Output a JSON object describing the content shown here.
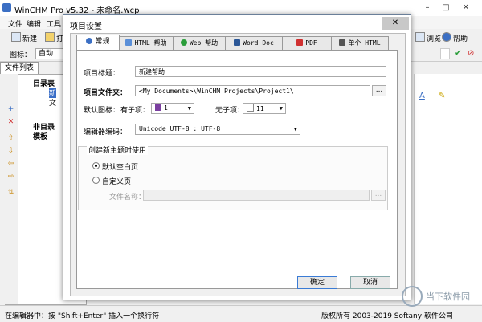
{
  "window": {
    "title": "WinCHM Pro v5.32 - 未命名.wcp"
  },
  "menu": [
    "文件",
    "编辑",
    "工具"
  ],
  "toolbar": {
    "new_label": "新建",
    "open_label": "打开",
    "view_label": "浏览",
    "help_label": "帮助",
    "icon_label": "图标：",
    "icon_value": "自动"
  },
  "side_tab": "文件列表",
  "tree": [
    "目录表",
    "新",
    "文",
    "非目录",
    "模板"
  ],
  "statusbar": {
    "left": "在编辑器中：按 \"Shift+Enter\" 插入一个换行符",
    "right": "版权所有 2003-2019 Softany 软件公司"
  },
  "dialog": {
    "title": "项目设置",
    "close_glyph": "✕",
    "tabs": [
      "常规",
      "HTML 帮助",
      "Web 帮助",
      "Word Doc",
      "PDF",
      "单个 HTML"
    ],
    "active_tab": 0,
    "project_title_label": "项目标题：",
    "project_title_value": "新建帮助",
    "project_folder_label": "项目文件夹：",
    "project_folder_value": "<My Documents>\\WinCHM Projects\\Project1\\",
    "browse_label": "...",
    "default_icon_label": "默认图标：",
    "with_children_label": "有子项：",
    "with_children_value": "1",
    "without_children_label": "无子项：",
    "without_children_value": "11",
    "encoding_label": "编辑器编码：",
    "encoding_value": "Unicode UTF-8 : UTF-8",
    "group_title": "创建新主题时使用",
    "radio_default": "默认空白页",
    "radio_custom": "自定义页",
    "filename_label": "文件名称：",
    "filename_value": "",
    "ok_label": "确定",
    "cancel_label": "取消"
  },
  "watermark": "当下软件园"
}
